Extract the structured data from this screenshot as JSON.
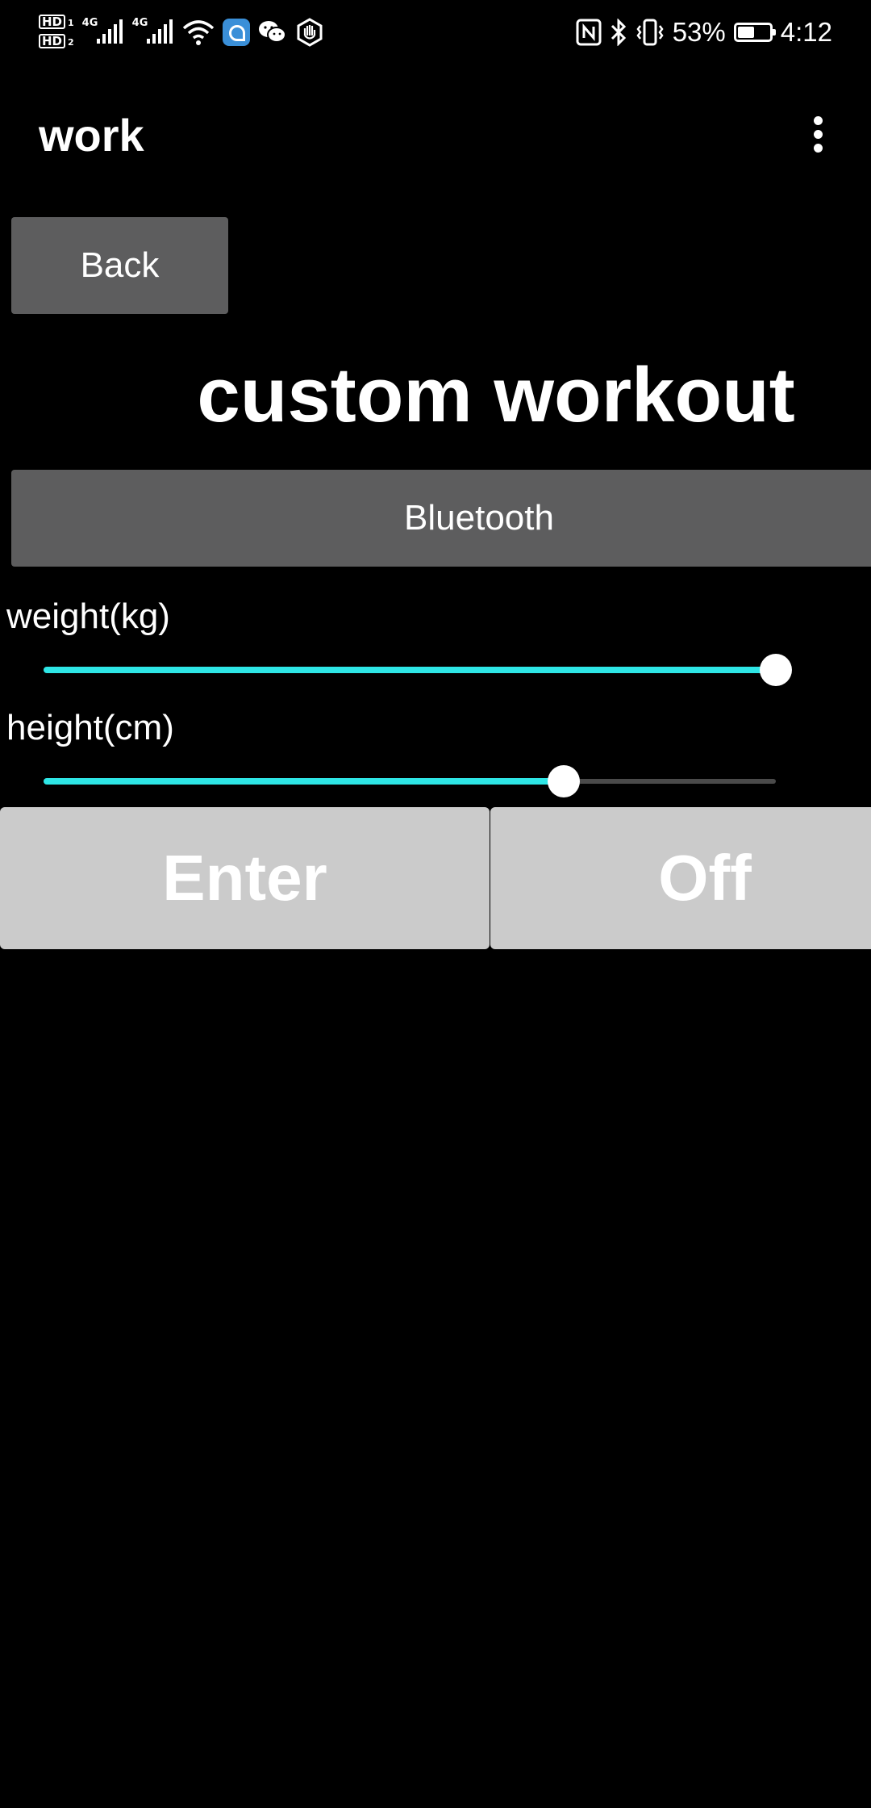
{
  "status_bar": {
    "sim1": "HD",
    "sim1_num": "1",
    "sim2": "HD",
    "sim2_num": "2",
    "net1": "4G",
    "net2": "4G",
    "icons_left": [
      "signal-icon",
      "signal-icon",
      "wifi-icon",
      "app-notification-icon",
      "wechat-icon",
      "hand-icon"
    ],
    "icons_right": [
      "nfc-icon",
      "bluetooth-icon",
      "vibrate-icon"
    ],
    "battery_pct": "53%",
    "battery_level": 0.53,
    "time": "4:12"
  },
  "app_bar": {
    "title": "work"
  },
  "main": {
    "back_label": "Back",
    "heading": "custom workout",
    "bluetooth_label": "Bluetooth",
    "weight_label": "weight(kg)",
    "weight_value": 1.0,
    "height_label": "height(cm)",
    "height_value": 0.71,
    "enter_label": "Enter",
    "off_label": "Off"
  },
  "colors": {
    "background": "#000000",
    "dark_button": "#5d5d5e",
    "light_button": "#cbcbcb",
    "slider_accent": "#2ee6e6"
  }
}
